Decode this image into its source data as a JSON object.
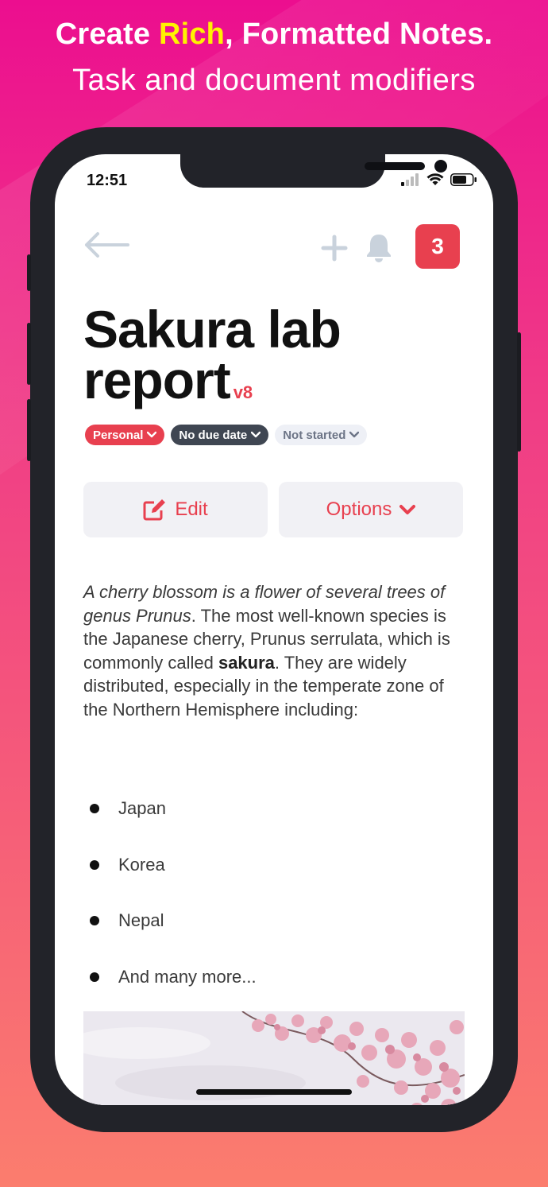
{
  "promo": {
    "headline_prefix": "Create ",
    "headline_highlight": "Rich",
    "headline_suffix": ", Formatted Notes.",
    "subheadline": "Task and document modifiers"
  },
  "status_bar": {
    "time": "12:51"
  },
  "toolbar": {
    "notification_count": "3"
  },
  "note": {
    "title": "Sakura lab report",
    "version": "v8",
    "tags": {
      "category": "Personal",
      "due": "No due date",
      "status": "Not started"
    },
    "actions": {
      "edit_label": "Edit",
      "options_label": "Options"
    },
    "body": {
      "italic": "A cherry blossom is a flower of several trees of genus Prunus",
      "part1": ". The most well-known species is the Japanese cherry, Prunus serrulata, which is commonly called ",
      "bold": "sakura",
      "part2": ". They are widely distributed, especially in the temperate zone of the Northern Hemisphere including:"
    },
    "list": [
      "Japan",
      "Korea",
      "Nepal",
      "And many more..."
    ]
  },
  "colors": {
    "accent": "#e8404f",
    "highlight": "#fff200",
    "background_top": "#ec0e8f",
    "background_bottom": "#fb7d6e"
  }
}
